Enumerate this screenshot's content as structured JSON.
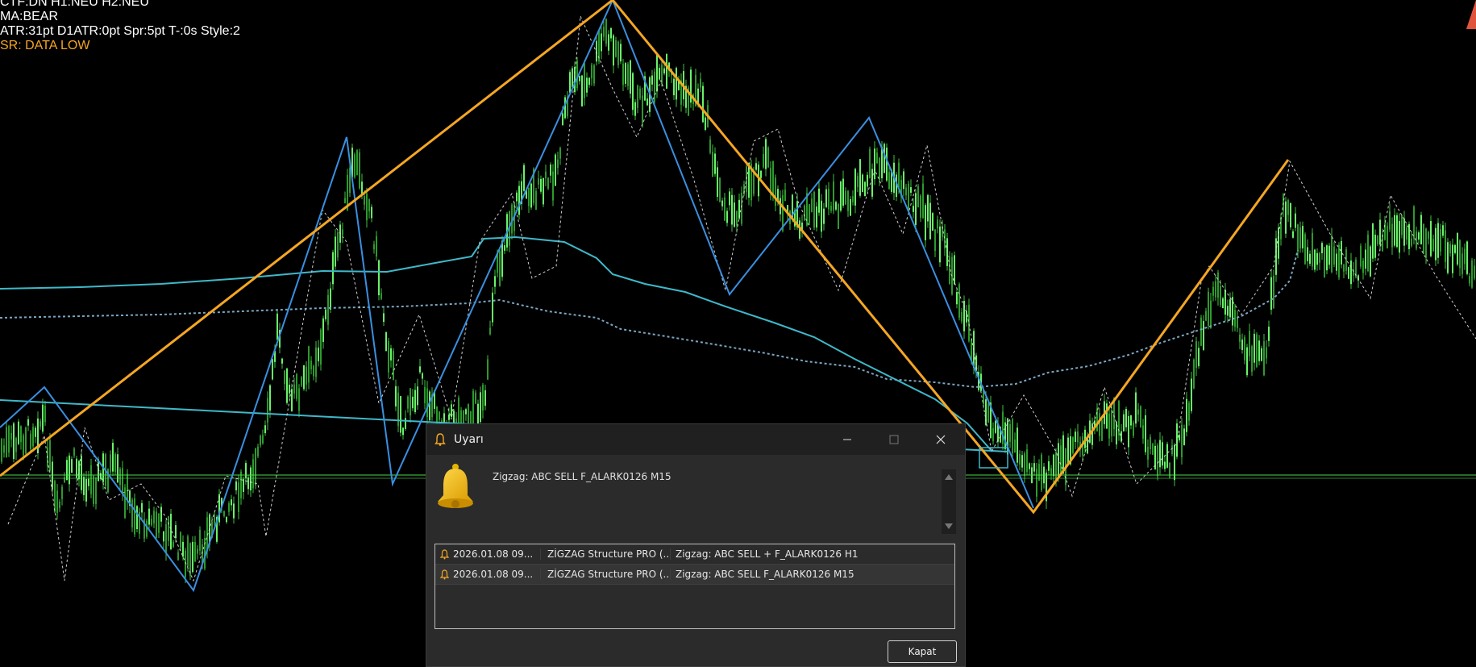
{
  "info": {
    "line1": "CTF:DN  H1:NEU  H2:NEU",
    "line2": "MA:BEAR",
    "line3": "ATR:31pt  D1ATR:0pt  Spr:5pt  T-:0s  Style:2",
    "line4": "SR: DATA LOW"
  },
  "colors": {
    "candle": "#4cd94c",
    "zigzag_major": "#f5a623",
    "zigzag_minor": "#3a8fe0",
    "ma_fast": "#3fb8c9",
    "ma_slow_dotted": "#7aa6c2",
    "warning_text": "#f5a623"
  },
  "dialog": {
    "title": "Uyarı",
    "icon": "bell-icon",
    "message": "Zigzag: ABC SELL   F_ALARK0126 M15",
    "alerts": [
      {
        "time": "2026.01.08 09...",
        "source": "ZİGZAG Structure PRO (...",
        "message": "Zigzag: ABC SELL +  F_ALARK0126 H1"
      },
      {
        "time": "2026.01.08 09...",
        "source": "ZİGZAG Structure PRO (...",
        "message": "Zigzag: ABC SELL   F_ALARK0126 M15"
      }
    ],
    "close_label": "Kapat"
  }
}
